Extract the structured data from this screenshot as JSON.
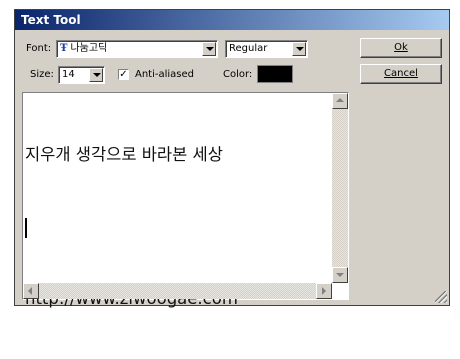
{
  "window": {
    "title": "Text Tool"
  },
  "font": {
    "label": "Font:",
    "value": "나눔고딕",
    "icon": "truetype-icon",
    "style_value": "Regular"
  },
  "size": {
    "label": "Size:",
    "value": "14"
  },
  "antialias": {
    "label": "Anti-aliased",
    "checked": true,
    "check_glyph": "✓"
  },
  "color": {
    "label": "Color:",
    "value": "#000000"
  },
  "buttons": {
    "ok": "Ok",
    "cancel": "Cancel"
  },
  "editor": {
    "line1": "지우개 생각으로 바라본 세상",
    "line2": "",
    "line3": "http://www.ziwoogae.com"
  },
  "colors": {
    "title_start": "#0a246a",
    "title_end": "#a6caf0",
    "face": "#d4d0c8"
  }
}
